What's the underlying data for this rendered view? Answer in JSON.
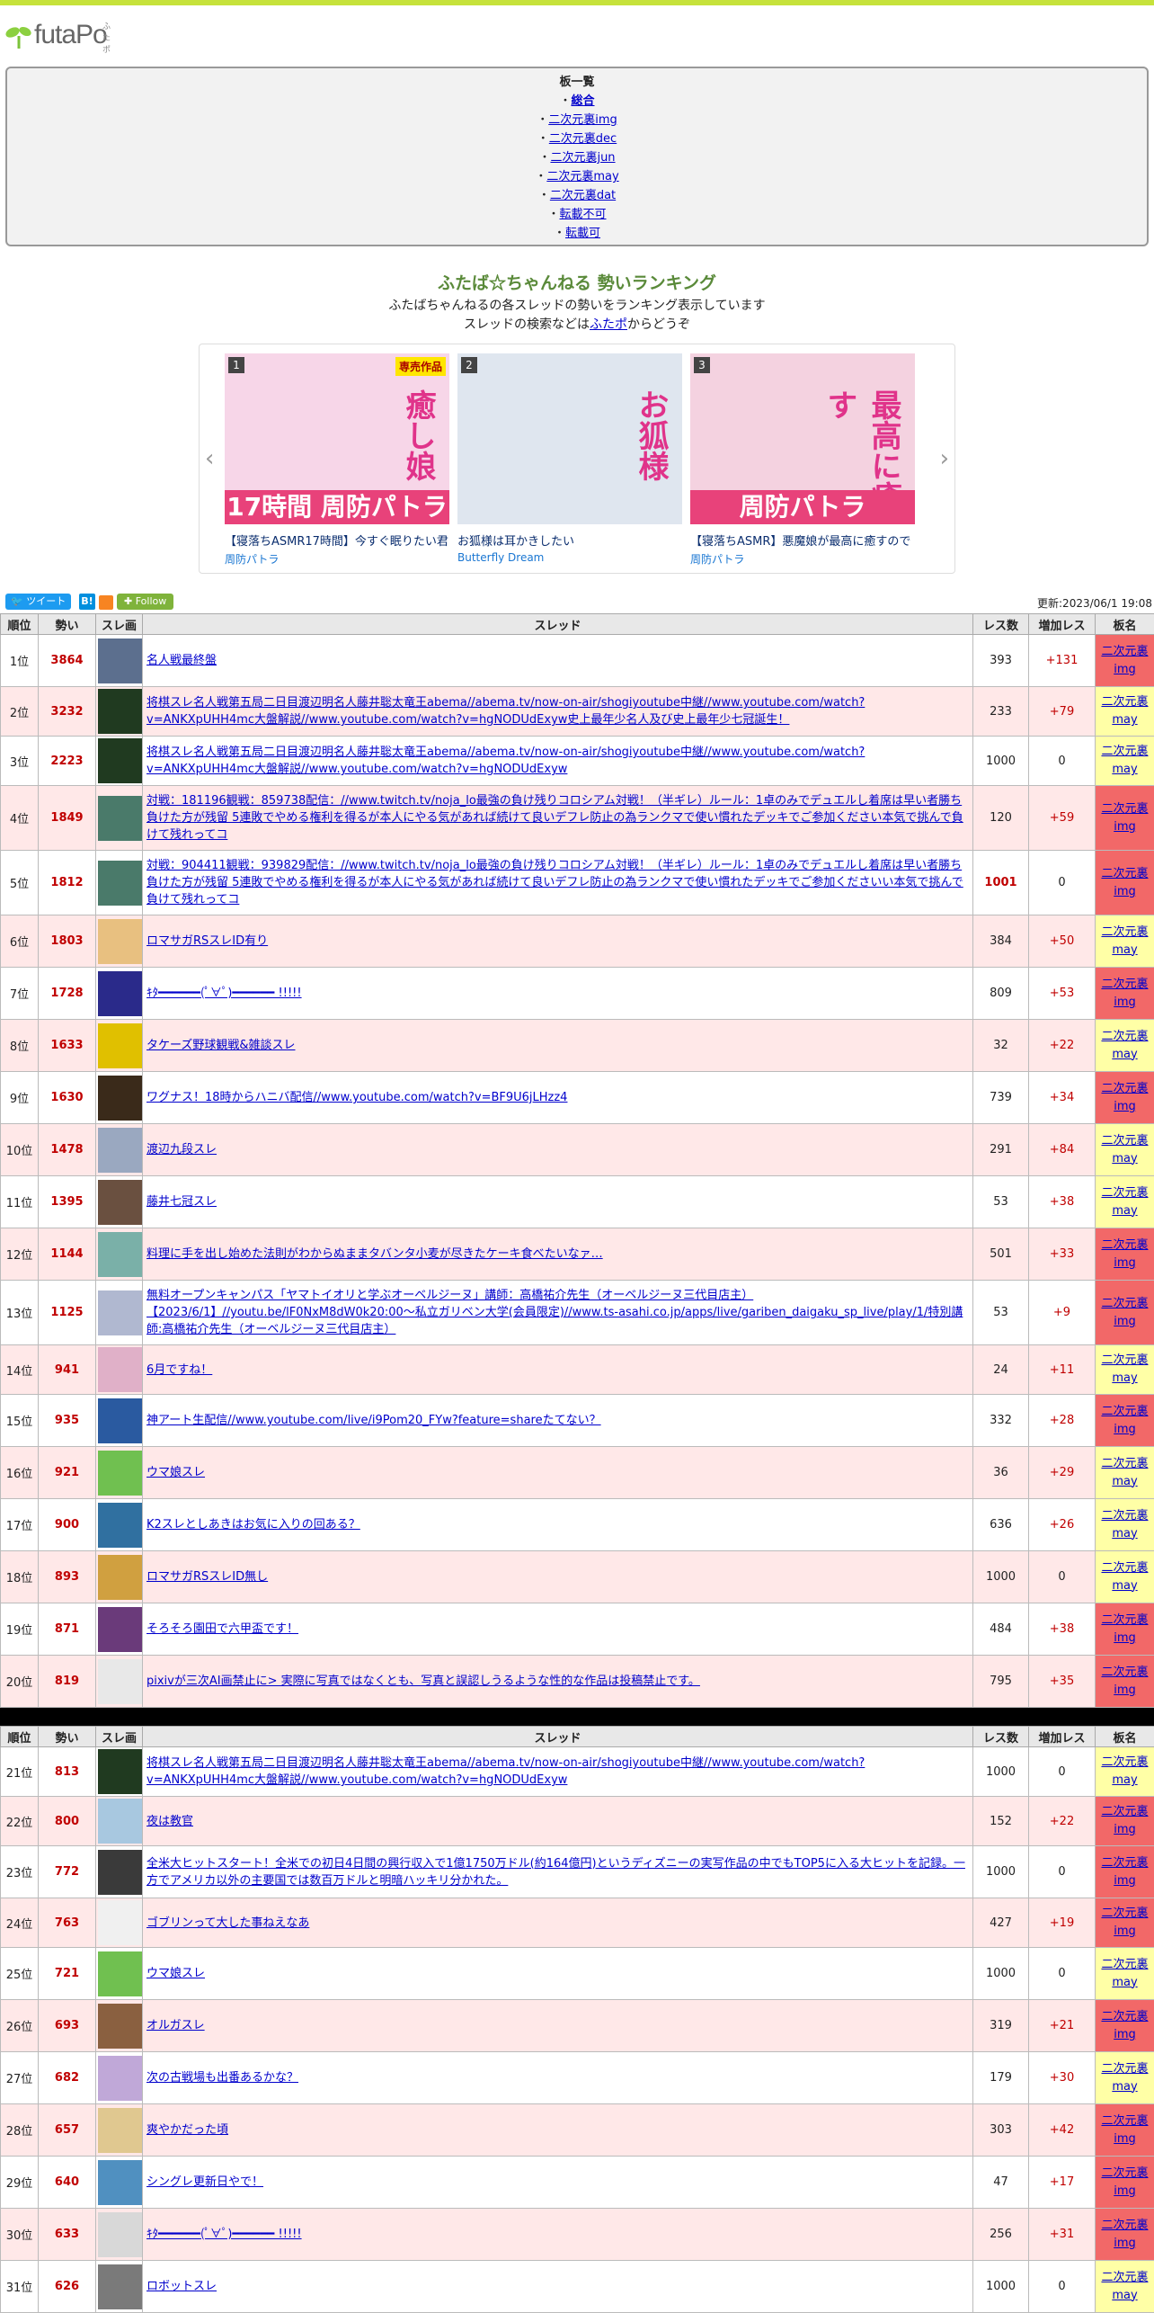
{
  "logo": {
    "text": "futaPo",
    "ruby": "ふたポ"
  },
  "boards": {
    "title": "板一覧",
    "items": [
      {
        "label": "総合",
        "bold": true
      },
      {
        "label": "二次元裏img",
        "bold": false
      },
      {
        "label": "二次元裏dec",
        "bold": false
      },
      {
        "label": "二次元裏jun",
        "bold": false
      },
      {
        "label": "二次元裏may",
        "bold": false
      },
      {
        "label": "二次元裏dat",
        "bold": false
      },
      {
        "label": "転載不可",
        "bold": false
      },
      {
        "label": "転載可",
        "bold": false
      }
    ]
  },
  "ranking": {
    "title": "ふたば☆ちゃんねる 勢いランキング",
    "desc1": "ふたばちゃんねるの各スレッドの勢いをランキング表示しています",
    "desc2_pre": "スレッドの検索などは",
    "desc2_link": "ふたポ",
    "desc2_post": "からどうぞ"
  },
  "carousel": [
    {
      "num": "1",
      "badge": "専売作品",
      "caption": "【寝落ちASMR17時間】今すぐ眠りたい君",
      "circle": "周防パトラ",
      "big": "癒し娘",
      "banner": "17時間 周防パトラ",
      "bg": "#f7d6e8"
    },
    {
      "num": "2",
      "badge": "",
      "caption": "お狐様は耳かきしたい",
      "circle": "Butterfly Dream",
      "big": "お狐様",
      "banner": "",
      "bg": "#dfe6ef"
    },
    {
      "num": "3",
      "badge": "",
      "caption": "【寝落ちASMR】悪魔娘が最高に癒すので",
      "circle": "周防パトラ",
      "big": "最高に癒す",
      "banner": "周防パトラ",
      "bg": "#f4d2e0"
    }
  ],
  "toolbar": {
    "tweet": "ツイート",
    "hatena": "B!",
    "follow": "Follow",
    "updated": "更新:2023/06/1 19:08"
  },
  "headers": {
    "rank": "順位",
    "ikioi": "勢い",
    "thumb": "スレ画",
    "thread": "スレッド",
    "res": "レス数",
    "inc": "増加レス",
    "board": "板名"
  },
  "rows1": [
    {
      "rank": "1位",
      "ikioi": "3864",
      "title": "名人戦最終盤",
      "res": "393",
      "inc": "+131",
      "b1": "二次元裏",
      "b2": "img",
      "bcls": "img",
      "thumb": "#5c6f8e",
      "h": 58
    },
    {
      "rank": "2位",
      "ikioi": "3232",
      "title": "将棋スレ名人戦第五局二日目渡辺明名人藤井聡太竜王abema//abema.tv/now-on-air/shogiyoutube中継//www.youtube.com/watch?v=ANKXpUHH4mc大盤解説//www.youtube.com/watch?v=hgNODUdExyw史上最年少名人及び史上最年少七冠誕生！",
      "res": "233",
      "inc": "+79",
      "b1": "二次元裏",
      "b2": "may",
      "bcls": "may",
      "thumb": "#203a20",
      "h": 52
    },
    {
      "rank": "3位",
      "ikioi": "2223",
      "title": "将棋スレ名人戦第五局二日目渡辺明名人藤井聡太竜王abema//abema.tv/now-on-air/shogiyoutube中継//www.youtube.com/watch?v=ANKXpUHH4mc大盤解説//www.youtube.com/watch?v=hgNODUdExyw",
      "res": "1000",
      "inc": "0",
      "b1": "二次元裏",
      "b2": "may",
      "bcls": "may",
      "thumb": "#203a20",
      "h": 52
    },
    {
      "rank": "4位",
      "ikioi": "1849",
      "title": "対戦：181196観戦：859738配信：//www.twitch.tv/noja_lo最強の負け残りコロシアム対戦！（半ギレ）ルール：1卓のみでデュエルし着席は早い者勝ち 負けた方が残留 5連敗でやめる権利を得るが本人にやる気があれば続けて良いデフレ防止の為ランクマで使い慣れたデッキでご参加ください本気で挑んで負けて残れってコ",
      "res": "120",
      "inc": "+59",
      "b1": "二次元裏",
      "b2": "img",
      "bcls": "img",
      "thumb": "#4a7a6a",
      "h": 72
    },
    {
      "rank": "5位",
      "ikioi": "1812",
      "title": "対戦：904411観戦：939829配信：//www.twitch.tv/noja_lo最強の負け残りコロシアム対戦！（半ギレ）ルール：1卓のみでデュエルし着席は早い者勝ち 負けた方が残留 5連敗でやめる権利を得るが本人にやる気があれば続けて良いデフレ防止の為ランクマで使い慣れたデッキでご参加くださいい本気で挑んで負けて残れってコ",
      "res": "1001",
      "inc": "0",
      "b1": "二次元裏",
      "b2": "img",
      "bcls": "img",
      "thumb": "#4a7a6a",
      "h": 72,
      "hot": true
    },
    {
      "rank": "6位",
      "ikioi": "1803",
      "title": "ロマサガRSスレID有り",
      "res": "384",
      "inc": "+50",
      "b1": "二次元裏",
      "b2": "may",
      "bcls": "may",
      "thumb": "#e8c080",
      "h": 58
    },
    {
      "rank": "7位",
      "ikioi": "1728",
      "title": "ｷﾀ━━━━━━(ﾟ∀ﾟ)━━━━━━ !!!!!",
      "res": "809",
      "inc": "+53",
      "b1": "二次元裏",
      "b2": "img",
      "bcls": "img",
      "thumb": "#2a2a8a",
      "h": 58
    },
    {
      "rank": "8位",
      "ikioi": "1633",
      "title": "タケーズ野球観戦&雑談スレ",
      "res": "32",
      "inc": "+22",
      "b1": "二次元裏",
      "b2": "may",
      "bcls": "may",
      "thumb": "#e0c000",
      "h": 58
    },
    {
      "rank": "9位",
      "ikioi": "1630",
      "title": "ワグナス！18時からハニバ配信//www.youtube.com/watch?v=BF9U6jLHzz4",
      "res": "739",
      "inc": "+34",
      "b1": "二次元裏",
      "b2": "img",
      "bcls": "img",
      "thumb": "#3a2a1a",
      "h": 58
    },
    {
      "rank": "10位",
      "ikioi": "1478",
      "title": "渡辺九段スレ",
      "res": "291",
      "inc": "+84",
      "b1": "二次元裏",
      "b2": "may",
      "bcls": "may",
      "thumb": "#9aa8c0",
      "h": 58
    },
    {
      "rank": "11位",
      "ikioi": "1395",
      "title": "藤井七冠スレ",
      "res": "53",
      "inc": "+38",
      "b1": "二次元裏",
      "b2": "may",
      "bcls": "may",
      "thumb": "#6a5040",
      "h": 58
    },
    {
      "rank": "12位",
      "ikioi": "1144",
      "title": "料理に手を出し始めた法則がわからぬままタバンタ小麦が尽きたケーキ食べたいなァ…",
      "res": "501",
      "inc": "+33",
      "b1": "二次元裏",
      "b2": "img",
      "bcls": "img",
      "thumb": "#7ab0a8",
      "h": 58
    },
    {
      "rank": "13位",
      "ikioi": "1125",
      "title": "無料オープンキャンパス「ヤマトイオリと学ぶオーベルジーヌ」講師：高橋祐介先生（オーベルジーヌ三代目店主）【2023/6/1】//youtu.be/lF0NxM8dW0k20:00～私立ガリベン大学(会員限定)//www.ts-asahi.co.jp/apps/live/gariben_daigaku_sp_live/play/1/特別講師:高橋祐介先生（オーベルジーヌ三代目店主）",
      "res": "53",
      "inc": "+9",
      "b1": "二次元裏",
      "b2": "img",
      "bcls": "img",
      "thumb": "#b0b8d0",
      "h": 72
    },
    {
      "rank": "14位",
      "ikioi": "941",
      "title": "6月ですね！",
      "res": "24",
      "inc": "+11",
      "b1": "二次元裏",
      "b2": "may",
      "bcls": "may",
      "thumb": "#e0b0c8",
      "h": 34
    },
    {
      "rank": "15位",
      "ikioi": "935",
      "title": "神アート生配信//www.youtube.com/live/i9Pom20_FYw?feature=shareたてない？",
      "res": "332",
      "inc": "+28",
      "b1": "二次元裏",
      "b2": "img",
      "bcls": "img",
      "thumb": "#2a5aa0",
      "h": 58
    },
    {
      "rank": "16位",
      "ikioi": "921",
      "title": "ウマ娘スレ",
      "res": "36",
      "inc": "+29",
      "b1": "二次元裏",
      "b2": "may",
      "bcls": "may",
      "thumb": "#70c050",
      "h": 58
    },
    {
      "rank": "17位",
      "ikioi": "900",
      "title": "K2スレとしあきはお気に入りの回ある？",
      "res": "636",
      "inc": "+26",
      "b1": "二次元裏",
      "b2": "may",
      "bcls": "may",
      "thumb": "#3070a0",
      "h": 58
    },
    {
      "rank": "18位",
      "ikioi": "893",
      "title": "ロマサガRSスレID無し",
      "res": "1000",
      "inc": "0",
      "b1": "二次元裏",
      "b2": "may",
      "bcls": "may",
      "thumb": "#d0a040",
      "h": 58
    },
    {
      "rank": "19位",
      "ikioi": "871",
      "title": "そろそろ園田で六甲盃です！",
      "res": "484",
      "inc": "+38",
      "b1": "二次元裏",
      "b2": "img",
      "bcls": "img",
      "thumb": "#6a3a7a",
      "h": 58
    },
    {
      "rank": "20位",
      "ikioi": "819",
      "title": "pixivが三次AI画禁止に> 実際に写真ではなくとも、写真と誤認しうるような性的な作品は投稿禁止です。",
      "res": "795",
      "inc": "+35",
      "b1": "二次元裏",
      "b2": "img",
      "bcls": "img",
      "thumb": "#e8e8e8",
      "h": 58
    }
  ],
  "rows2": [
    {
      "rank": "21位",
      "ikioi": "813",
      "title": "将棋スレ名人戦第五局二日目渡辺明名人藤井聡太竜王abema//abema.tv/now-on-air/shogiyoutube中継//www.youtube.com/watch?v=ANKXpUHH4mc大盤解説//www.youtube.com/watch?v=hgNODUdExyw",
      "res": "1000",
      "inc": "0",
      "b1": "二次元裏",
      "b2": "may",
      "bcls": "may",
      "thumb": "#203a20",
      "h": 52
    },
    {
      "rank": "22位",
      "ikioi": "800",
      "title": "夜は教官",
      "res": "152",
      "inc": "+22",
      "b1": "二次元裏",
      "b2": "img",
      "bcls": "img",
      "thumb": "#a8c8e0",
      "h": 52
    },
    {
      "rank": "23位",
      "ikioi": "772",
      "title": "全米大ヒットスタート！全米での初日4日間の興行収入で1億1750万ドル(約164億円)というディズニーの実写作品の中でもTOP5に入る大ヒットを記録。一方でアメリカ以外の主要国では数百万ドルと明暗ハッキリ分かれた。",
      "res": "1000",
      "inc": "0",
      "b1": "二次元裏",
      "b2": "img",
      "bcls": "img",
      "thumb": "#3a3a3a",
      "h": 58
    },
    {
      "rank": "24位",
      "ikioi": "763",
      "title": "ゴブリンって大した事ねえなあ",
      "res": "427",
      "inc": "+19",
      "b1": "二次元裏",
      "b2": "img",
      "bcls": "img",
      "thumb": "#f0f0f0",
      "h": 52
    },
    {
      "rank": "25位",
      "ikioi": "721",
      "title": "ウマ娘スレ",
      "res": "1000",
      "inc": "0",
      "b1": "二次元裏",
      "b2": "may",
      "bcls": "may",
      "thumb": "#70c050",
      "h": 58
    },
    {
      "rank": "26位",
      "ikioi": "693",
      "title": "オルガスレ",
      "res": "319",
      "inc": "+21",
      "b1": "二次元裏",
      "b2": "img",
      "bcls": "img",
      "thumb": "#8a6040",
      "h": 58
    },
    {
      "rank": "27位",
      "ikioi": "682",
      "title": "次の古戦場も出番あるかな？",
      "res": "179",
      "inc": "+30",
      "b1": "二次元裏",
      "b2": "may",
      "bcls": "may",
      "thumb": "#c0a8d8",
      "h": 58
    },
    {
      "rank": "28位",
      "ikioi": "657",
      "title": "爽やかだった頃",
      "res": "303",
      "inc": "+42",
      "b1": "二次元裏",
      "b2": "img",
      "bcls": "img",
      "thumb": "#e0c890",
      "h": 58
    },
    {
      "rank": "29位",
      "ikioi": "640",
      "title": "シングレ更新日やで！",
      "res": "47",
      "inc": "+17",
      "b1": "二次元裏",
      "b2": "img",
      "bcls": "img",
      "thumb": "#5090c0",
      "h": 58
    },
    {
      "rank": "30位",
      "ikioi": "633",
      "title": "ｷﾀ━━━━━━(ﾟ∀ﾟ)━━━━━━ !!!!!",
      "res": "256",
      "inc": "+31",
      "b1": "二次元裏",
      "b2": "img",
      "bcls": "img",
      "thumb": "#d8d8d8",
      "h": 58
    },
    {
      "rank": "31位",
      "ikioi": "626",
      "title": "ロボットスレ",
      "res": "1000",
      "inc": "0",
      "b1": "二次元裏",
      "b2": "may",
      "bcls": "may",
      "thumb": "#7a7a7a",
      "h": 58
    }
  ]
}
